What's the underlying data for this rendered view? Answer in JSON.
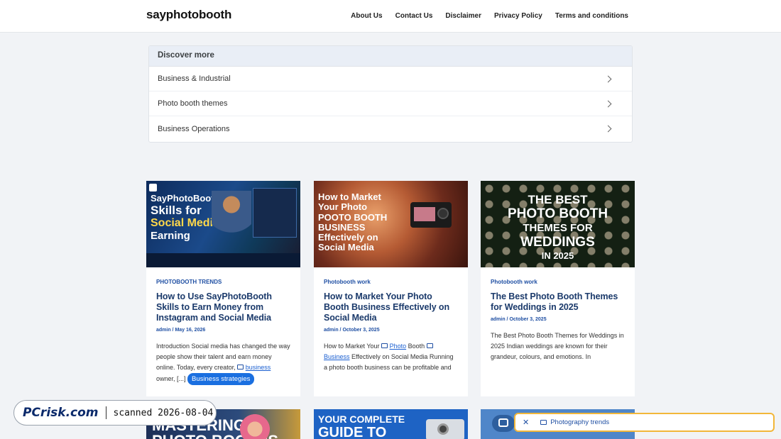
{
  "site": {
    "logo": "sayphotobooth"
  },
  "nav": {
    "items": [
      "About Us",
      "Contact Us",
      "Disclaimer",
      "Privacy Policy",
      "Terms and conditions"
    ]
  },
  "discover": {
    "heading": "Discover more",
    "items": [
      "Business & Industrial",
      "Photo booth themes",
      "Business Operations"
    ]
  },
  "cards": [
    {
      "category": "PHOTOBOOTH TRENDS",
      "title": "How to Use SayPhotoBooth Skills to Earn Money from Instagram and Social Media",
      "meta": "admin / May 16, 2026",
      "excerpt_a": "Introduction Social media has changed the way people show their talent and earn money online. Today, every creator,",
      "kw": "business",
      "excerpt_b": "owner, [...]",
      "pill": "Business strategies",
      "thumb": {
        "l1": "SayPhotoBooth",
        "l2": "Skills for",
        "l3": "Social Media",
        "l4": "Earning"
      }
    },
    {
      "category": "Photobooth work",
      "title": "How to Market Your Photo Booth Business Effectively on Social Media",
      "meta": "admin / October 3, 2025",
      "excerpt_a": "How to Market Your",
      "kw1": "Photo",
      "mid": "Booth",
      "kw2": "Business",
      "excerpt_b": "Effectively on Social Media Running a photo booth business can be profitable and",
      "thumb": {
        "l1": "How to Market",
        "l2": "Your Photo",
        "l3": "POOTO BOOTH",
        "l4": "BUSINESS",
        "l5": "Effectively on",
        "l6": "Social Media"
      }
    },
    {
      "category": "Photobooth work",
      "title": "The Best Photo Booth Themes for Weddings in 2025",
      "meta": "admin / October 3, 2025",
      "excerpt": "The Best Photo Booth Themes for Weddings in 2025 Indian weddings are known for their grandeur, colours, and emotions. In",
      "thumb": {
        "l1": "THE BEST",
        "l2": "PHOTO BOOTH",
        "l3": "THEMES FOR",
        "l4": "WEDDINGS",
        "l5": "IN 2025"
      }
    }
  ],
  "bottom_cards": [
    {
      "text": "MASTERING",
      "text2": "PHOTO BOOTHS"
    },
    {
      "text": "YOUR COMPLETE",
      "text2": "GUIDE TO"
    },
    {
      "text": ""
    }
  ],
  "watermark": {
    "logo": "PCrisk.com",
    "text": "scanned 2026-08-04"
  },
  "toast": {
    "close": "✕",
    "label": "Photography trends"
  }
}
